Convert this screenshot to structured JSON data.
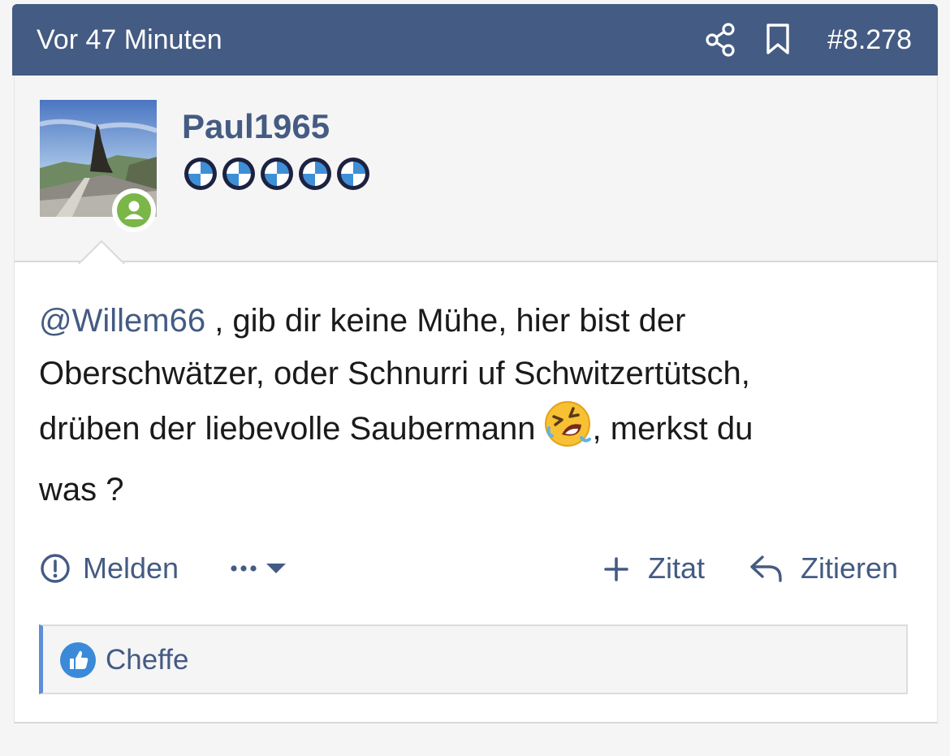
{
  "post": {
    "time": "Vor 47 Minuten",
    "number": "#8.278",
    "icons": {
      "share": "share-icon",
      "bookmark": "bookmark-icon"
    },
    "header_color": "#445b83"
  },
  "author": {
    "username": "Paul1965",
    "online_status_icon": "user-online-icon",
    "rank_icon": "rank-roundels-icon",
    "rank_count": 5
  },
  "message": {
    "mention": "@Willem66",
    "line1": " , gib dir keine Mühe, hier bist der",
    "line2": "Oberschwätzer, oder Schnurri uf Schwitzertütsch,",
    "line3a": "drüben der liebevolle Saubermann",
    "line3b": ", merkst du",
    "line4": "was ?",
    "emoji_icon": "rolling-laughing-emoji"
  },
  "actions": {
    "report": "Melden",
    "more_icon": "more-dots-dropdown-icon",
    "quote_plus": "Zitat",
    "reply": "Zitieren"
  },
  "reactions": {
    "icon": "thumbs-up-icon",
    "user": "Cheffe"
  },
  "colors": {
    "accent": "#445b83",
    "online": "#7ab648",
    "reaction_border": "#5b8fd6"
  }
}
